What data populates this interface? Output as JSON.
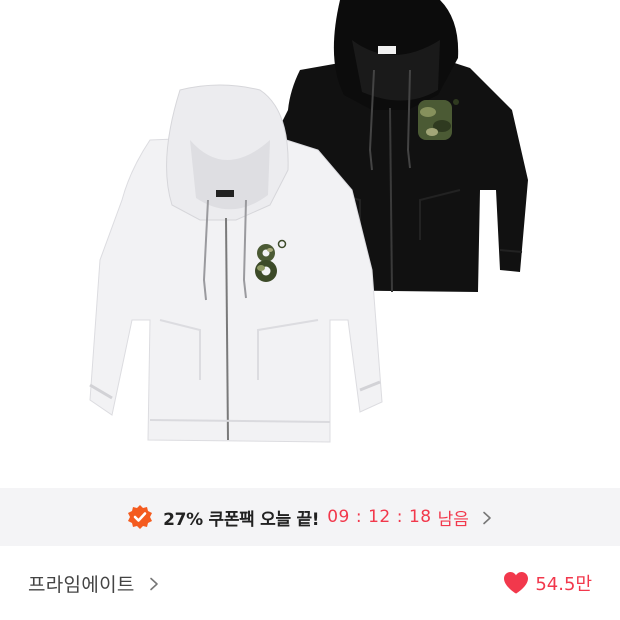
{
  "product": {
    "image_alt": "white and black zip-up hoodies with camo 8 logo"
  },
  "coupon": {
    "text": "27% 쿠폰팩 오늘 끝!",
    "timer": {
      "hours": "09",
      "minutes": "12",
      "seconds": "18"
    },
    "suffix": "남음",
    "badge_icon": "verified-badge-icon",
    "chevron_icon": "chevron-right-icon"
  },
  "brand": {
    "name": "프라임에이트",
    "chevron_icon": "chevron-right-icon"
  },
  "likes": {
    "count": "54.5만",
    "icon": "heart-icon"
  },
  "colors": {
    "accent": "#f2384c",
    "badge": "#f45b1f",
    "bar_background": "#f4f4f6"
  }
}
